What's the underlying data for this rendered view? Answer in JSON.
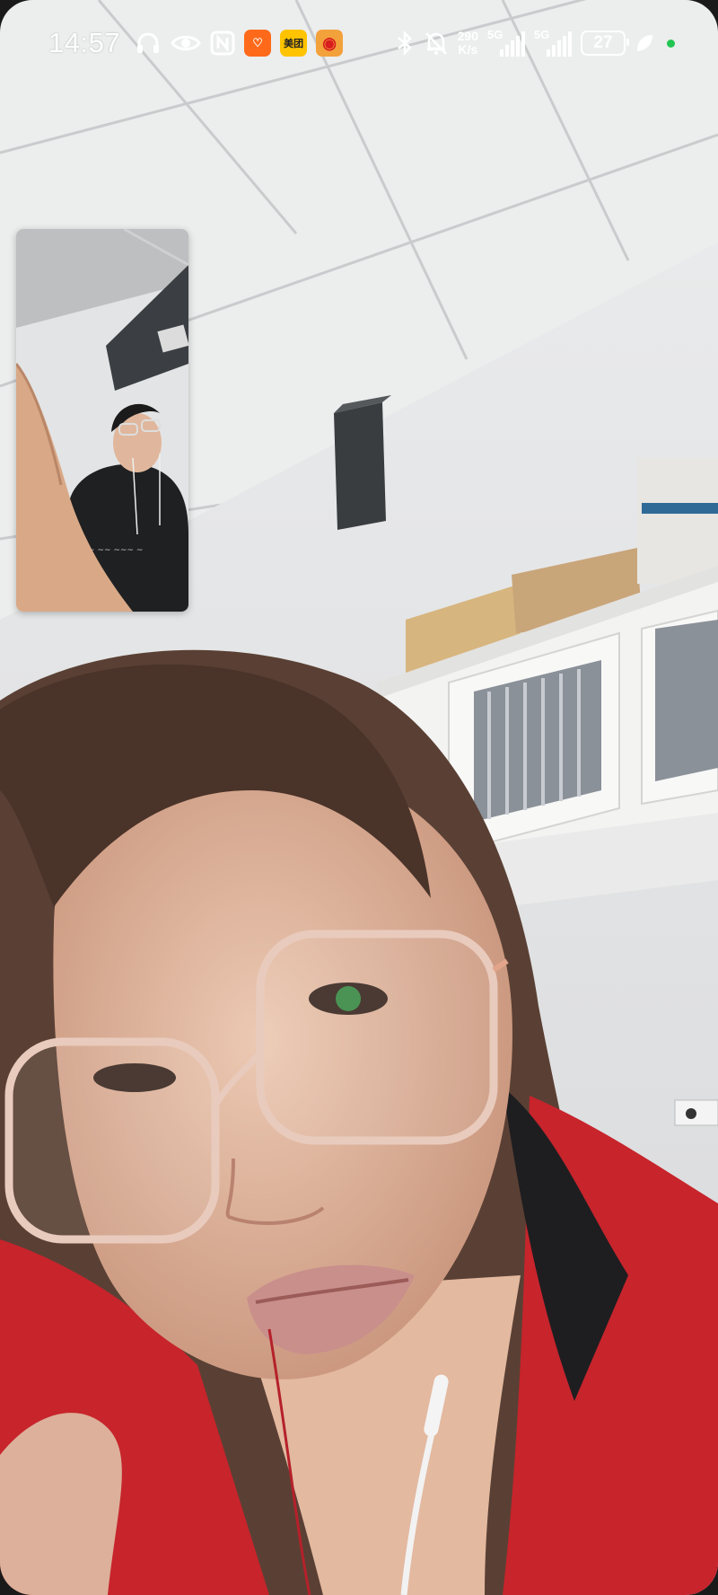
{
  "status_bar": {
    "time": "14:57",
    "app_badges": [
      {
        "name": "taobao",
        "text": "♡",
        "color": "#ff6a1a"
      },
      {
        "name": "meituan",
        "text": "美团",
        "color": "#ffc300"
      },
      {
        "name": "weibo",
        "text": "◉",
        "color": "#f3a13b"
      }
    ],
    "net_speed_value": "290",
    "net_speed_unit": "K/s",
    "sim1_label": "5G",
    "sim2_label": "5G",
    "battery_level": "27",
    "icons": [
      "headphones-icon",
      "eye-icon",
      "nfc-icon",
      "bluetooth-icon",
      "mute-bell-icon",
      "leaf-icon"
    ]
  },
  "call": {
    "remote_video": "remote-participant-video",
    "self_preview": "local-camera-preview"
  }
}
